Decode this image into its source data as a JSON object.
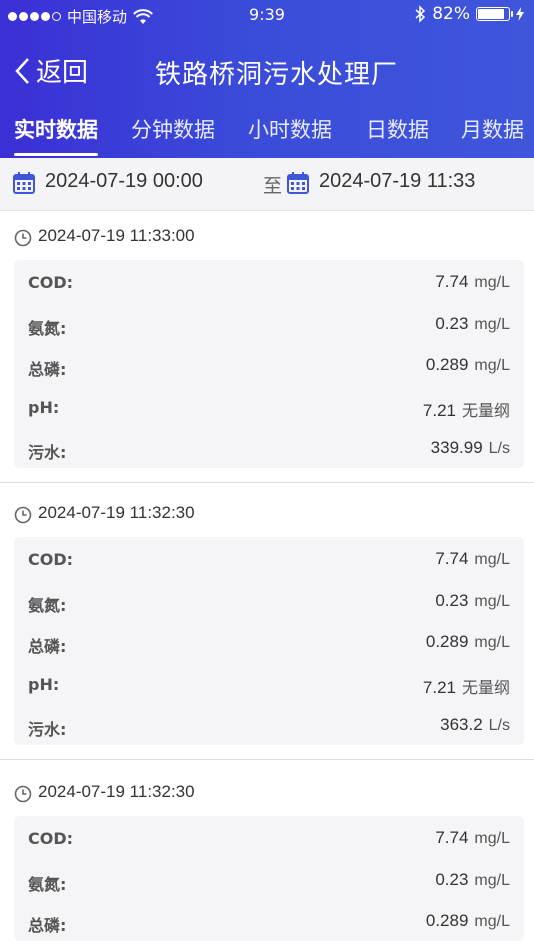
{
  "status": {
    "carrier": "中国移动",
    "time": "9:39",
    "battery": "82%"
  },
  "nav": {
    "back_label": "返回",
    "title": "铁路桥洞污水处理厂"
  },
  "tabs": [
    {
      "label": "实时数据",
      "active": true
    },
    {
      "label": "分钟数据",
      "active": false
    },
    {
      "label": "小时数据",
      "active": false
    },
    {
      "label": "日数据",
      "active": false
    },
    {
      "label": "月数据",
      "active": false
    }
  ],
  "date_range": {
    "start": "2024-07-19 00:00",
    "to_label": "至",
    "end": "2024-07-19 11:33"
  },
  "records": [
    {
      "time": "2024-07-19 11:33:00",
      "rows": [
        {
          "label": "COD:",
          "value": "7.74",
          "unit": "mg/L"
        },
        {
          "label": "氨氮:",
          "value": "0.23",
          "unit": "mg/L"
        },
        {
          "label": "总磷:",
          "value": "0.289",
          "unit": "mg/L"
        },
        {
          "label": "pH:",
          "value": "7.21",
          "unit": "无量纲"
        },
        {
          "label": "污水:",
          "value": "339.99",
          "unit": "L/s"
        }
      ]
    },
    {
      "time": "2024-07-19 11:32:30",
      "rows": [
        {
          "label": "COD:",
          "value": "7.74",
          "unit": "mg/L"
        },
        {
          "label": "氨氮:",
          "value": "0.23",
          "unit": "mg/L"
        },
        {
          "label": "总磷:",
          "value": "0.289",
          "unit": "mg/L"
        },
        {
          "label": "pH:",
          "value": "7.21",
          "unit": "无量纲"
        },
        {
          "label": "污水:",
          "value": "363.2",
          "unit": "L/s"
        }
      ]
    },
    {
      "time": "2024-07-19 11:32:30",
      "rows": [
        {
          "label": "COD:",
          "value": "7.74",
          "unit": "mg/L"
        },
        {
          "label": "氨氮:",
          "value": "0.23",
          "unit": "mg/L"
        },
        {
          "label": "总磷:",
          "value": "0.289",
          "unit": "mg/L"
        }
      ]
    }
  ],
  "colors": {
    "header_start": "#3b2fd6",
    "header_end": "#3f56db",
    "calendar_icon": "#3f56db"
  }
}
